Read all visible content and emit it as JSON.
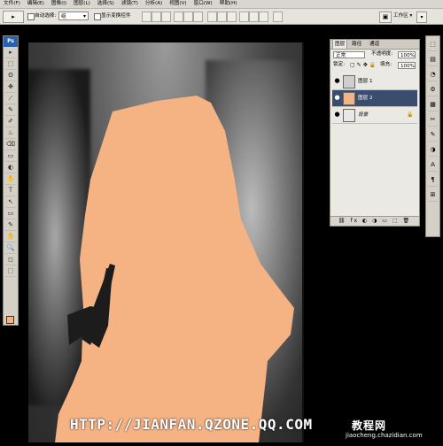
{
  "menu": [
    "文件(F)",
    "编辑(E)",
    "图像(I)",
    "图层(L)",
    "选择(S)",
    "滤镜(T)",
    "分析(A)",
    "视图(V)",
    "窗口(W)",
    "帮助(H)"
  ],
  "options": {
    "tool_glyph": "▸",
    "auto_select_label": "自动选择:",
    "auto_select_value": "组",
    "show_transform_label": "显示变换控件",
    "workspace_label": "工作区 ▾"
  },
  "toolbox": {
    "ps_label": "Ps",
    "tools": [
      "▸",
      "⬚",
      "ʘ",
      "✥",
      "⟋",
      "✎",
      "✐",
      "♨",
      "⌫",
      "▭",
      "◐",
      "✋",
      "Ｔ",
      "↖",
      "▭",
      "✎",
      "✋",
      "🔍",
      "◻",
      "⬚"
    ],
    "foreground_color": "#f4b483"
  },
  "layers_panel": {
    "tabs": [
      "图层",
      "路径",
      "通道"
    ],
    "blend_mode": "正常",
    "opacity_label": "不透明度:",
    "opacity_value": "100%",
    "lock_label": "锁定:",
    "fill_label": "填充:",
    "fill_value": "100%",
    "layers": [
      {
        "name": "图层 1",
        "selected": false,
        "thumb": "#cfcfcf"
      },
      {
        "name": "图层 2",
        "selected": true,
        "thumb": "#f4b483"
      },
      {
        "name": "背景",
        "selected": false,
        "thumb": "#e8e8e8"
      }
    ],
    "footer_icons": "⛓ fx ◐ ◑ ▭ ⬚ 🗑"
  },
  "right_dock": [
    "⬚",
    "▤",
    "◔",
    "⚙",
    "▦",
    "✂",
    "✎",
    "◑",
    "A",
    "¶",
    "⊞"
  ],
  "watermark": "HTTP://JIANFAN.QZONE.QQ.COM",
  "logo": {
    "brand": "教程网",
    "site": "jiaocheng.chazidian.com"
  },
  "colors": {
    "skin": "#f5b283",
    "hair_dark": "#2a2a2a",
    "selected_layer": "#3a4d6e"
  }
}
